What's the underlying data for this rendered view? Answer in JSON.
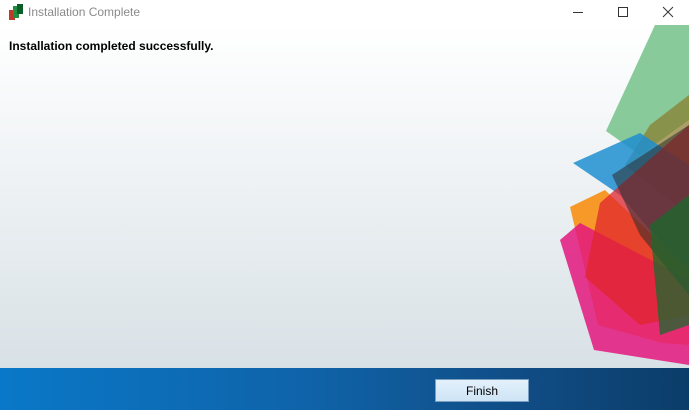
{
  "window": {
    "title": "Installation Complete",
    "icons": {
      "app": "installer-app-icon",
      "minimize": "minimize-icon",
      "maximize": "maximize-icon",
      "close": "close-icon"
    }
  },
  "content": {
    "message": "Installation completed successfully."
  },
  "footer": {
    "finish_label": "Finish"
  },
  "colors": {
    "footer_blue": "#0f63a8",
    "shape_green": "#7cc48f",
    "shape_blue": "#1f8ed0",
    "shape_orange": "#f7941d",
    "shape_red": "#e0262e",
    "shape_magenta": "#e3177e"
  }
}
